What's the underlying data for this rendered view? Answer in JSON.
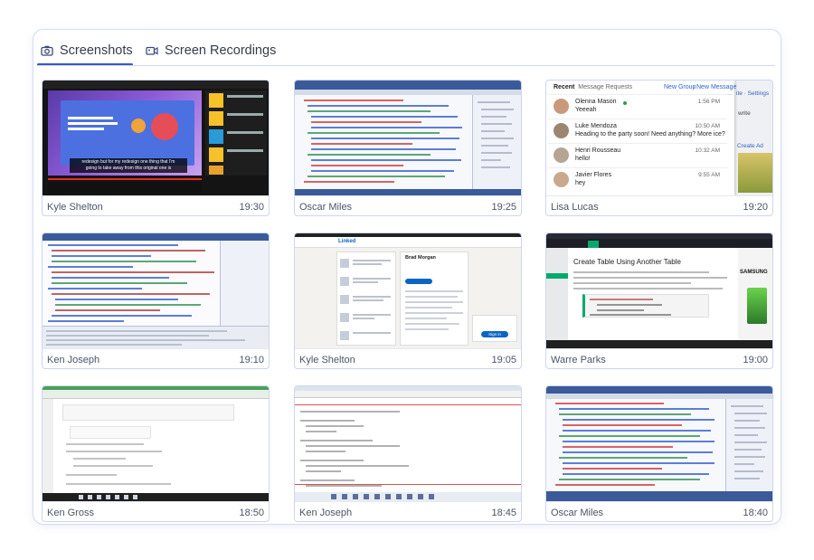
{
  "tabs": {
    "screenshots": "Screenshots",
    "recordings": "Screen Recordings",
    "screenshots_icon": "camera-icon",
    "recordings_icon": "video-camera-icon"
  },
  "colors": {
    "accent": "#3b57c9",
    "border": "#cdd6ef"
  },
  "cards": [
    {
      "name": "Kyle Shelton",
      "time": "19:30",
      "thumb": "video-player"
    },
    {
      "name": "Oscar Miles",
      "time": "19:25",
      "thumb": "ide"
    },
    {
      "name": "Lisa Lucas",
      "time": "19:20",
      "thumb": "messages"
    },
    {
      "name": "Ken Joseph",
      "time": "19:10",
      "thumb": "ide"
    },
    {
      "name": "Kyle Shelton",
      "time": "19:05",
      "thumb": "linkedin"
    },
    {
      "name": "Warre Parks",
      "time": "19:00",
      "thumb": "w3schools"
    },
    {
      "name": "Ken Gross",
      "time": "18:50",
      "thumb": "web-editor"
    },
    {
      "name": "Ken Joseph",
      "time": "18:45",
      "thumb": "editor"
    },
    {
      "name": "Oscar Miles",
      "time": "18:40",
      "thumb": "ide"
    }
  ],
  "video_thumb": {
    "caption_1": "redesign but for my redesign one thing that I'm",
    "caption_2": "going to take away from this original one is"
  },
  "messages_thumb": {
    "tab_recent": "Recent",
    "tab_requests": "Message Requests",
    "link_new_group": "New Group",
    "link_new_message": "New Message",
    "side_settings": "ite · Settings",
    "side_write": "write",
    "side_create_ad": "Create Ad",
    "items": [
      {
        "name": "Olenna Mason",
        "msg": "Yeeeah",
        "time": "1:56 PM",
        "online": true
      },
      {
        "name": "Luke Mendoza",
        "msg": "Heading to the party soon! Need anything? More ice?",
        "time": "10:50 AM",
        "online": false
      },
      {
        "name": "Henri Rousseau",
        "msg": "hello!",
        "time": "10:32 AM",
        "online": false
      },
      {
        "name": "Javier Flores",
        "msg": "hey",
        "time": "9:55 AM",
        "online": false
      }
    ]
  },
  "w3_thumb": {
    "title": "Create Table Using Another Table",
    "side": "SAMSUNG"
  },
  "linkedin_thumb": {
    "logo": "Linked",
    "profile_name": "Brad Morgan",
    "button": "Sign in"
  }
}
